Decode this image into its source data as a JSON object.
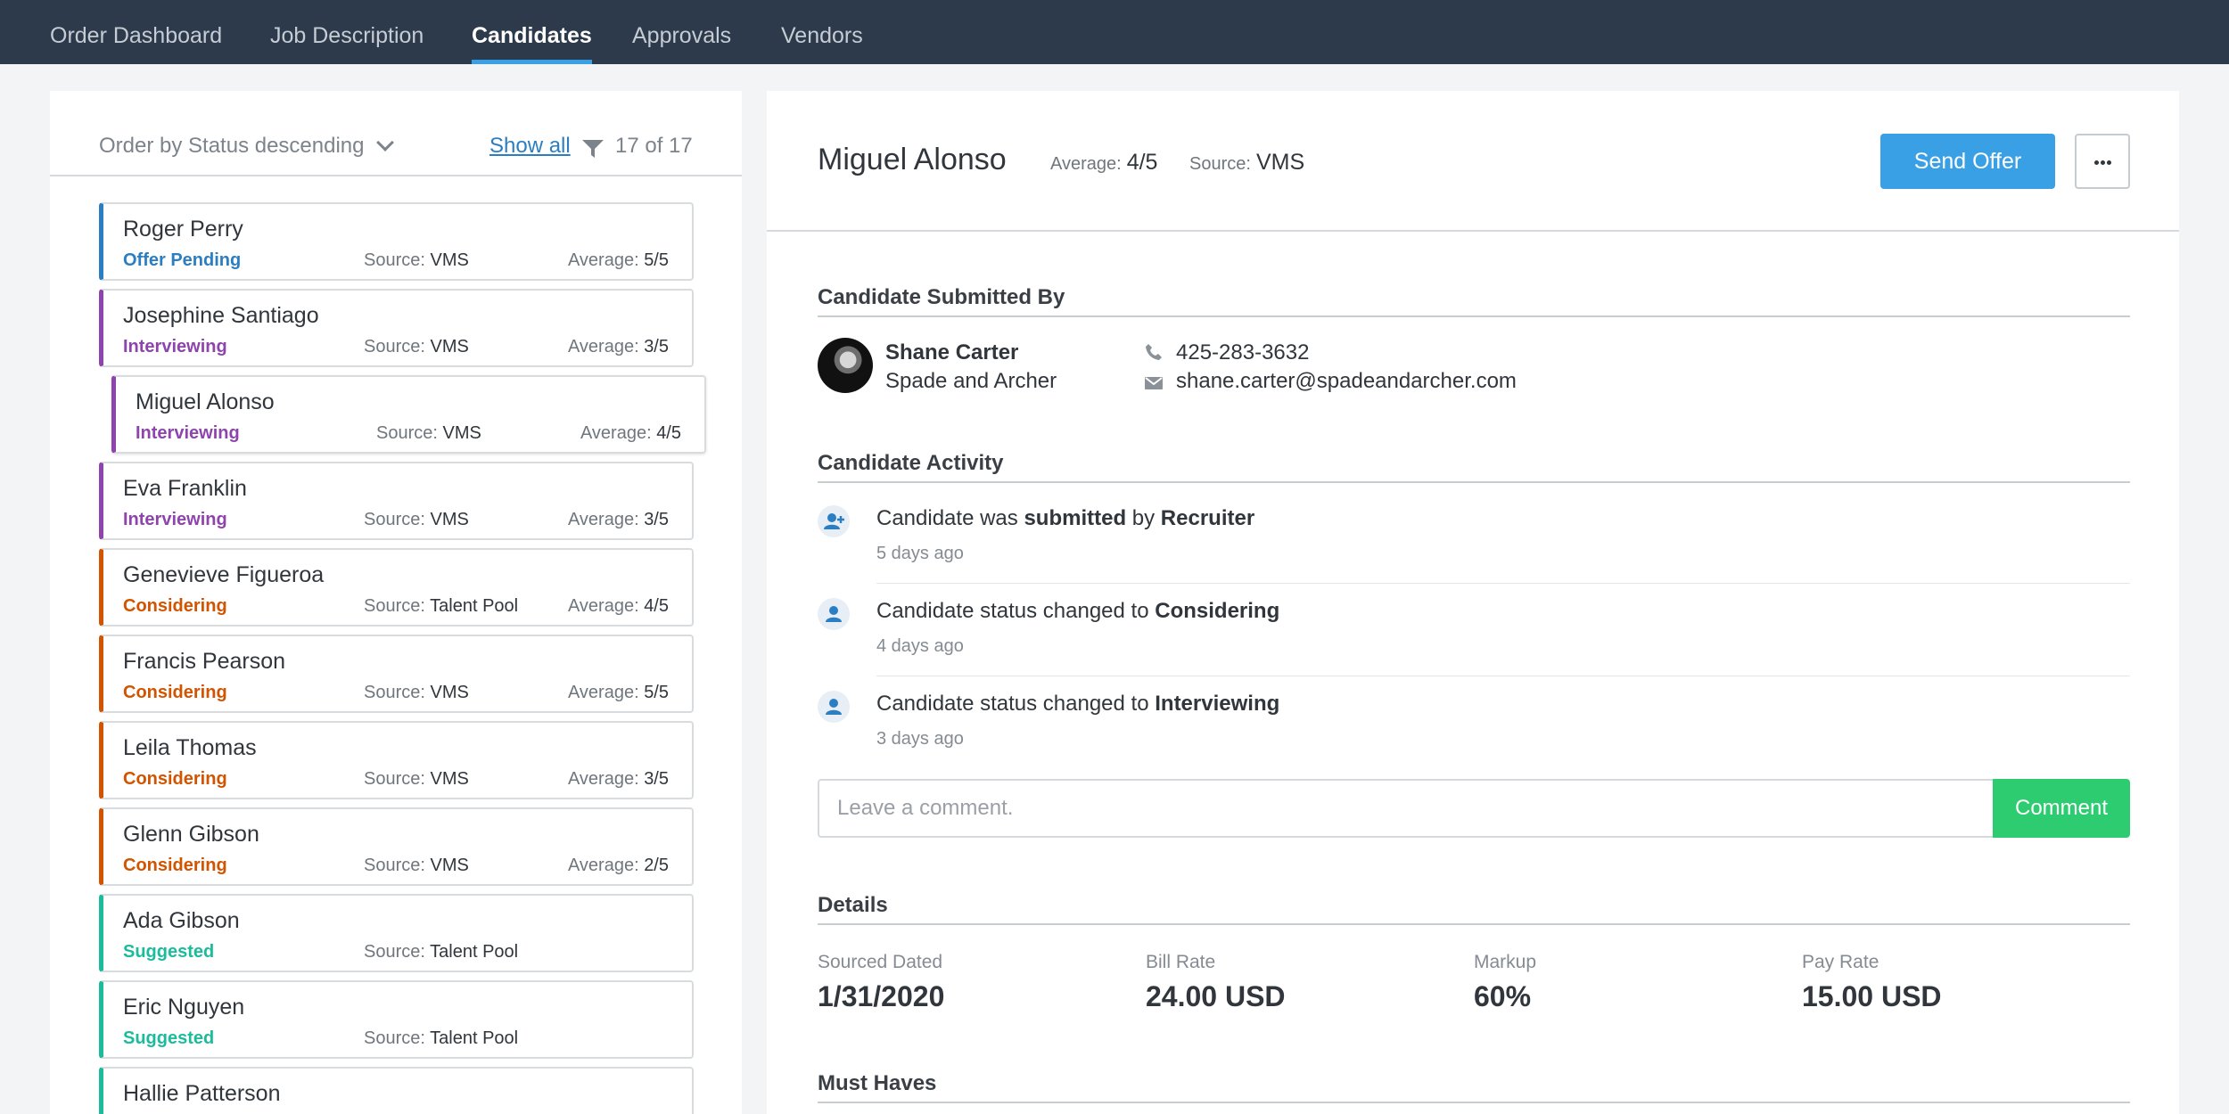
{
  "nav": {
    "tabs": [
      {
        "label": "Order Dashboard"
      },
      {
        "label": "Job Description"
      },
      {
        "label": "Candidates"
      },
      {
        "label": "Approvals"
      },
      {
        "label": "Vendors"
      }
    ],
    "active": "Candidates"
  },
  "list": {
    "order_label": "Order by Status descending",
    "show_all": "Show all",
    "count": "17 of 17",
    "source_label": "Source:",
    "average_label": "Average:",
    "candidates": [
      {
        "name": "Roger Perry",
        "status": "Offer Pending",
        "source": "VMS",
        "average": "5/5",
        "color": "#2b7ec1"
      },
      {
        "name": "Josephine Santiago",
        "status": "Interviewing",
        "source": "VMS",
        "average": "3/5",
        "color": "#8e44ad"
      },
      {
        "name": "Miguel Alonso",
        "status": "Interviewing",
        "source": "VMS",
        "average": "4/5",
        "color": "#8e44ad"
      },
      {
        "name": "Eva Franklin",
        "status": "Interviewing",
        "source": "VMS",
        "average": "3/5",
        "color": "#8e44ad"
      },
      {
        "name": "Genevieve Figueroa",
        "status": "Considering",
        "source": "Talent Pool",
        "average": "4/5",
        "color": "#d35400"
      },
      {
        "name": "Francis Pearson",
        "status": "Considering",
        "source": "VMS",
        "average": "5/5",
        "color": "#d35400"
      },
      {
        "name": "Leila Thomas",
        "status": "Considering",
        "source": "VMS",
        "average": "3/5",
        "color": "#d35400"
      },
      {
        "name": "Glenn Gibson",
        "status": "Considering",
        "source": "VMS",
        "average": "2/5",
        "color": "#d35400"
      },
      {
        "name": "Ada Gibson",
        "status": "Suggested",
        "source": "Talent Pool",
        "average": "",
        "color": "#1abc9c"
      },
      {
        "name": "Eric Nguyen",
        "status": "Suggested",
        "source": "Talent Pool",
        "average": "",
        "color": "#1abc9c"
      },
      {
        "name": "Hallie Patterson",
        "status": "",
        "source": "",
        "average": "",
        "color": "#1abc9c"
      }
    ]
  },
  "detail": {
    "name": "Miguel Alonso",
    "average_label": "Average:",
    "average": "4/5",
    "source_label": "Source:",
    "source": "VMS",
    "send_offer": "Send Offer",
    "submitted_title": "Candidate Submitted By",
    "submitter": {
      "name": "Shane Carter",
      "company": "Spade and Archer",
      "phone": "425-283-3632",
      "email": "shane.carter@spadeandarcher.com"
    },
    "activity_title": "Candidate Activity",
    "activity": [
      {
        "pre": "Candidate was ",
        "bold1": "submitted",
        "mid": " by ",
        "bold2": "Recruiter",
        "time": "5 days ago"
      },
      {
        "pre": "Candidate status changed to ",
        "bold1": "Considering",
        "mid": "",
        "bold2": "",
        "time": "4 days ago"
      },
      {
        "pre": "Candidate status changed to ",
        "bold1": "Interviewing",
        "mid": "",
        "bold2": "",
        "time": "3 days ago"
      }
    ],
    "comment_placeholder": "Leave a comment.",
    "comment_button": "Comment",
    "details_title": "Details",
    "details": [
      {
        "label": "Sourced Dated",
        "value": "1/31/2020"
      },
      {
        "label": "Bill Rate",
        "value": "24.00 USD"
      },
      {
        "label": "Markup",
        "value": "60%"
      },
      {
        "label": "Pay Rate",
        "value": "15.00 USD"
      }
    ],
    "must_haves_title": "Must Haves"
  },
  "colors": {
    "accent": "#3aa0e6",
    "nav_bg": "#2c3a4b",
    "comment_button": "#2ecc71"
  }
}
